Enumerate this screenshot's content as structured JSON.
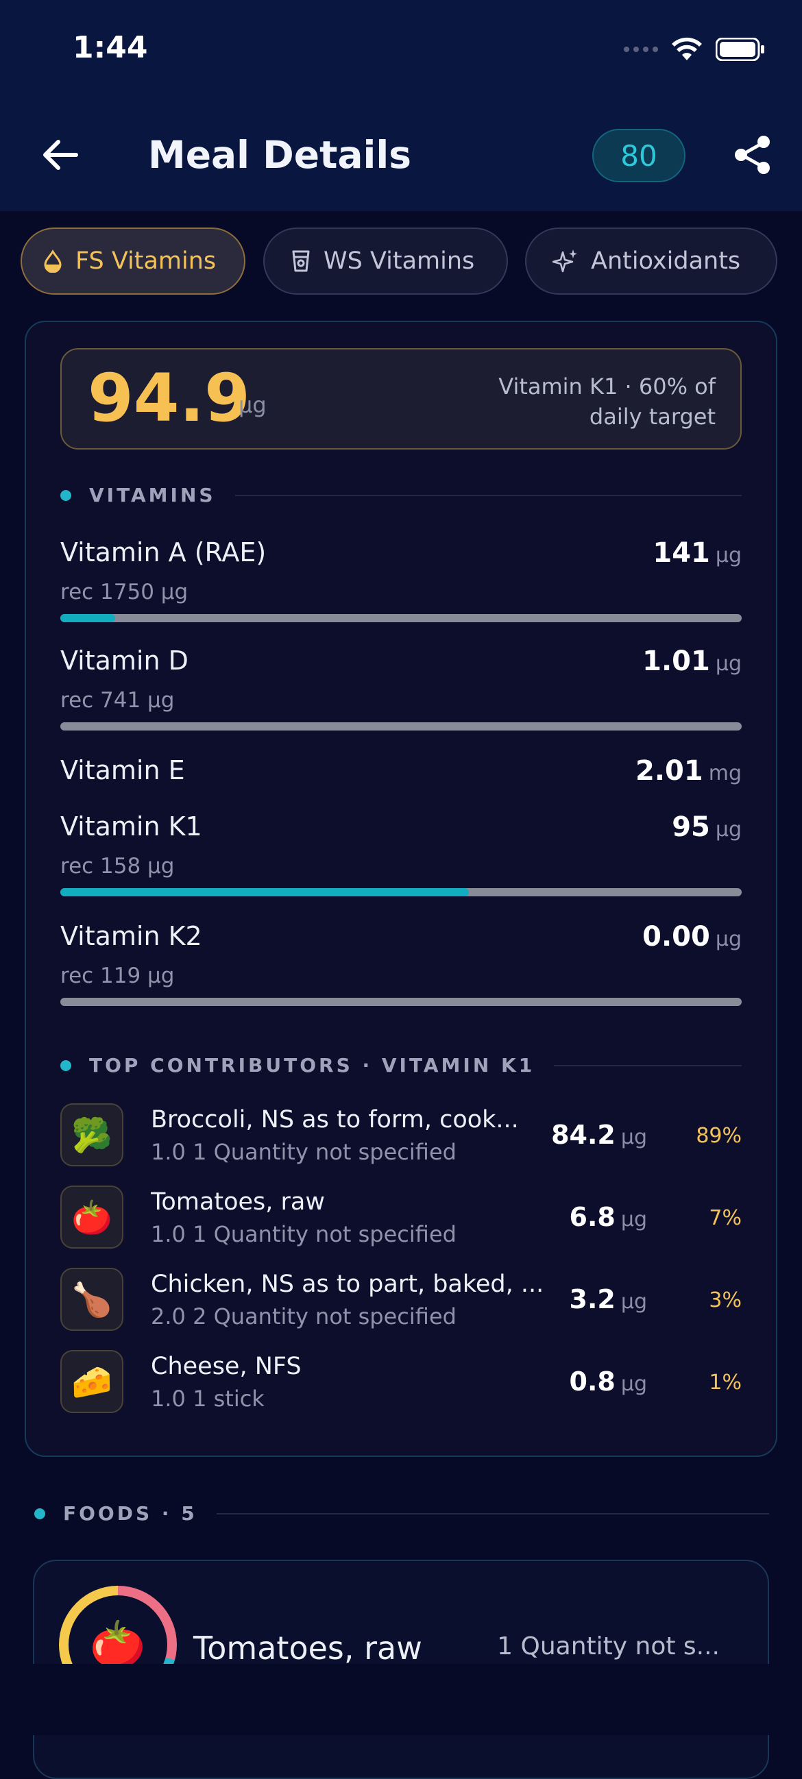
{
  "status": {
    "time": "1:44"
  },
  "nav": {
    "title": "Meal Details",
    "score": "80"
  },
  "tabs": [
    {
      "label": "FS Vitamins",
      "icon": "drop-icon",
      "active": true
    },
    {
      "label": "WS Vitamins",
      "icon": "cup-icon",
      "active": false
    },
    {
      "label": "Antioxidants",
      "icon": "sparkle-icon",
      "active": false
    }
  ],
  "summary": {
    "value": "94.9",
    "unit": "µg",
    "note": "Vitamin K1 · 60% of daily target"
  },
  "vitamins_section": {
    "title": "VITAMINS"
  },
  "vitamins": [
    {
      "name": "Vitamin A (RAE)",
      "value": "141",
      "unit": "µg",
      "rec": "rec 1750 µg",
      "progress": 0.08
    },
    {
      "name": "Vitamin D",
      "value": "1.01",
      "unit": "µg",
      "rec": "rec 741 µg",
      "progress": 0.0
    },
    {
      "name": "Vitamin E",
      "value": "2.01",
      "unit": "mg"
    },
    {
      "name": "Vitamin K1",
      "value": "95",
      "unit": "µg",
      "rec": "rec 158 µg",
      "progress": 0.6
    },
    {
      "name": "Vitamin K2",
      "value": "0.00",
      "unit": "µg",
      "rec": "rec 119 µg",
      "progress": 0.0
    }
  ],
  "contributors_section": {
    "title": "TOP CONTRIBUTORS · VITAMIN K1"
  },
  "contributors": [
    {
      "icon": "🥦",
      "name": "Broccoli, NS as to form, cook...",
      "sub": "1.0 1 Quantity not specified",
      "amount": "84.2",
      "unit": "µg",
      "pct": "89%"
    },
    {
      "icon": "🍅",
      "name": "Tomatoes, raw",
      "sub": "1.0 1 Quantity not specified",
      "amount": "6.8",
      "unit": "µg",
      "pct": "7%"
    },
    {
      "icon": "🍗",
      "name": "Chicken, NS as to part, baked, ...",
      "sub": "2.0 2 Quantity not specified",
      "amount": "3.2",
      "unit": "µg",
      "pct": "3%"
    },
    {
      "icon": "🧀",
      "name": "Cheese, NFS",
      "sub": "1.0 1 stick",
      "amount": "0.8",
      "unit": "µg",
      "pct": "1%"
    }
  ],
  "foods_section": {
    "title": "FOODS · 5"
  },
  "food_card": {
    "icon": "🍅",
    "name": "Tomatoes, raw",
    "qty": "1 Quantity not s..."
  },
  "colors": {
    "accent": "#23b6c8",
    "gold": "#f4c25a",
    "background": "#060a26"
  }
}
